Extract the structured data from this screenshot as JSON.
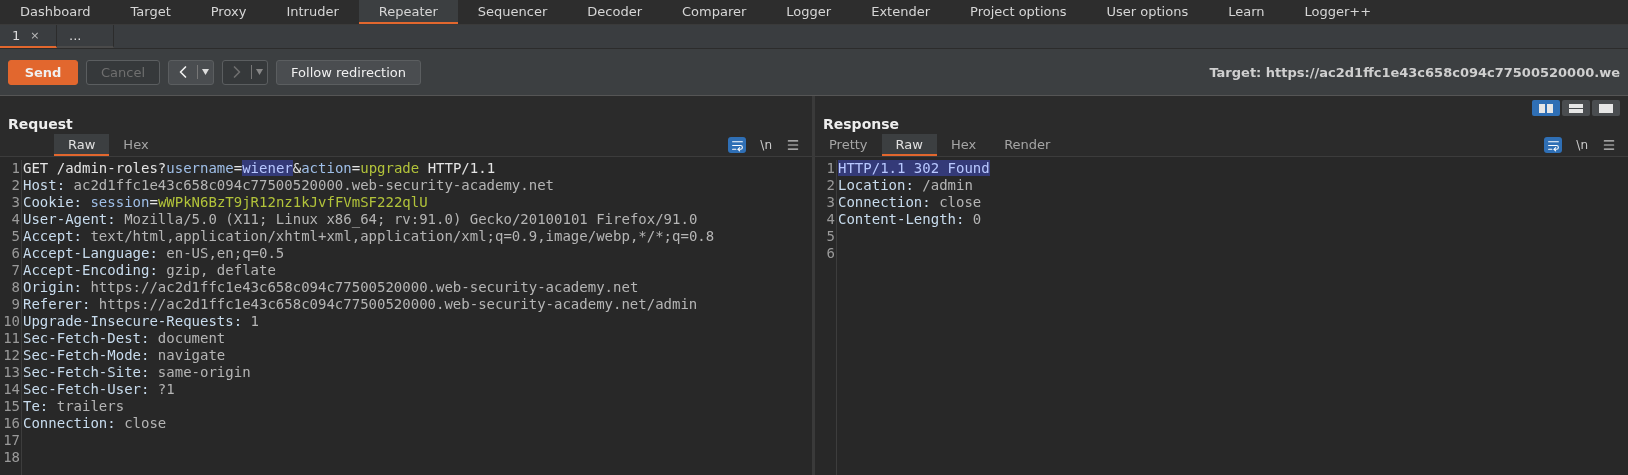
{
  "main_tabs": [
    {
      "label": "Dashboard",
      "selected": false
    },
    {
      "label": "Target",
      "selected": false
    },
    {
      "label": "Proxy",
      "selected": false
    },
    {
      "label": "Intruder",
      "selected": false
    },
    {
      "label": "Repeater",
      "selected": true
    },
    {
      "label": "Sequencer",
      "selected": false
    },
    {
      "label": "Decoder",
      "selected": false
    },
    {
      "label": "Comparer",
      "selected": false
    },
    {
      "label": "Logger",
      "selected": false
    },
    {
      "label": "Extender",
      "selected": false
    },
    {
      "label": "Project options",
      "selected": false
    },
    {
      "label": "User options",
      "selected": false
    },
    {
      "label": "Learn",
      "selected": false
    },
    {
      "label": "Logger++",
      "selected": false
    }
  ],
  "repeater_tabs": [
    {
      "label": "1",
      "close": "×",
      "selected": true
    },
    {
      "label": "...",
      "selected": false
    }
  ],
  "toolbar": {
    "buttons": [
      {
        "kind": "send",
        "label": "Send",
        "disabled": false
      },
      {
        "kind": "cancel",
        "label": "Cancel",
        "disabled": true
      },
      {
        "kind": "back",
        "disabled": false
      },
      {
        "kind": "forward",
        "disabled": true
      },
      {
        "kind": "follow",
        "label": "Follow redirection",
        "disabled": false
      }
    ],
    "target": "Target: https://ac2d1ffc1e43c658c094c77500520000.we"
  },
  "layout_buttons": [
    {
      "kind": "side",
      "selected": true
    },
    {
      "kind": "stacked",
      "selected": false
    },
    {
      "kind": "single",
      "selected": false
    }
  ],
  "panels": [
    {
      "title": "Request",
      "tabs": [
        {
          "label": "Raw",
          "selected": true
        },
        {
          "label": "Hex",
          "selected": false
        }
      ],
      "wrap_on": true,
      "newline": "\\n",
      "lines": [
        [
          {
            "kind": "plain",
            "text": "GET /admin-roles?"
          },
          {
            "kind": "param",
            "text": "username"
          },
          {
            "kind": "plain",
            "text": "="
          },
          {
            "kind": "selected",
            "text": "wiener"
          },
          {
            "kind": "plain",
            "text": "&"
          },
          {
            "kind": "param",
            "text": "action"
          },
          {
            "kind": "plain",
            "text": "="
          },
          {
            "kind": "green",
            "text": "upgrade"
          },
          {
            "kind": "plain",
            "text": " HTTP/1.1"
          }
        ],
        [
          {
            "kind": "key",
            "text": "Host: "
          },
          {
            "kind": "value",
            "text": "ac2d1ffc1e43c658c094c77500520000.web-security-academy.net"
          }
        ],
        [
          {
            "kind": "key",
            "text": "Cookie: "
          },
          {
            "kind": "param",
            "text": "session"
          },
          {
            "kind": "plain",
            "text": "="
          },
          {
            "kind": "green",
            "text": "wWPkN6BzT9jR12nz1kJvfFVmSF222qlU"
          }
        ],
        [
          {
            "kind": "key",
            "text": "User-Agent: "
          },
          {
            "kind": "value",
            "text": "Mozilla/5.0 (X11; Linux x86_64; rv:91.0) Gecko/20100101 Firefox/91.0"
          }
        ],
        [
          {
            "kind": "key",
            "text": "Accept: "
          },
          {
            "kind": "value",
            "text": "text/html,application/xhtml+xml,application/xml;q=0.9,image/webp,*/*;q=0.8"
          }
        ],
        [
          {
            "kind": "key",
            "text": "Accept-Language: "
          },
          {
            "kind": "value",
            "text": "en-US,en;q=0.5"
          }
        ],
        [
          {
            "kind": "key",
            "text": "Accept-Encoding: "
          },
          {
            "kind": "value",
            "text": "gzip, deflate"
          }
        ],
        [
          {
            "kind": "key",
            "text": "Origin: "
          },
          {
            "kind": "value",
            "text": "https://ac2d1ffc1e43c658c094c77500520000.web-security-academy.net"
          }
        ],
        [
          {
            "kind": "key",
            "text": "Referer: "
          },
          {
            "kind": "value",
            "text": "https://ac2d1ffc1e43c658c094c77500520000.web-security-academy.net/admin"
          }
        ],
        [
          {
            "kind": "key",
            "text": "Upgrade-Insecure-Requests: "
          },
          {
            "kind": "value",
            "text": "1"
          }
        ],
        [
          {
            "kind": "key",
            "text": "Sec-Fetch-Dest: "
          },
          {
            "kind": "value",
            "text": "document"
          }
        ],
        [
          {
            "kind": "key",
            "text": "Sec-Fetch-Mode: "
          },
          {
            "kind": "value",
            "text": "navigate"
          }
        ],
        [
          {
            "kind": "key",
            "text": "Sec-Fetch-Site: "
          },
          {
            "kind": "value",
            "text": "same-origin"
          }
        ],
        [
          {
            "kind": "key",
            "text": "Sec-Fetch-User: "
          },
          {
            "kind": "value",
            "text": "?1"
          }
        ],
        [
          {
            "kind": "key",
            "text": "Te: "
          },
          {
            "kind": "value",
            "text": "trailers"
          }
        ],
        [
          {
            "kind": "key",
            "text": "Connection: "
          },
          {
            "kind": "value",
            "text": "close"
          }
        ]
      ],
      "line_numbers": [
        "1",
        "2",
        "3",
        "4",
        "5",
        "6",
        "7",
        "8",
        "9",
        "10",
        "11",
        "12",
        "13",
        "14",
        "15",
        "16",
        "17",
        "18"
      ]
    },
    {
      "title": "Response",
      "tabs": [
        {
          "label": "Pretty",
          "selected": false
        },
        {
          "label": "Raw",
          "selected": true
        },
        {
          "label": "Hex",
          "selected": false
        },
        {
          "label": "Render",
          "selected": false
        }
      ],
      "wrap_on": true,
      "newline": "\\n",
      "lines": [
        [
          {
            "kind": "selected",
            "text": "HTTP/1.1 302 Found"
          }
        ],
        [
          {
            "kind": "key",
            "text": "Location: "
          },
          {
            "kind": "value",
            "text": "/admin"
          }
        ],
        [
          {
            "kind": "key",
            "text": "Connection: "
          },
          {
            "kind": "value",
            "text": "close"
          }
        ],
        [
          {
            "kind": "key",
            "text": "Content-Length: "
          },
          {
            "kind": "value",
            "text": "0"
          }
        ]
      ],
      "line_numbers": [
        "1",
        "2",
        "3",
        "4",
        "5",
        "6"
      ]
    }
  ]
}
